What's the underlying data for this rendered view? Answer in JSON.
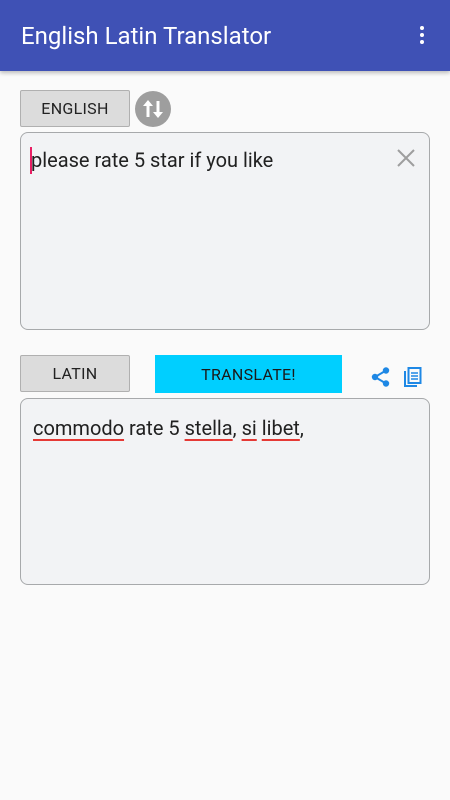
{
  "app": {
    "title": "English Latin Translator"
  },
  "source": {
    "language": "ENGLISH",
    "text": "please rate 5 star if you like"
  },
  "target": {
    "language": "LATIN",
    "segments": [
      {
        "text": "commodo",
        "misspelled": true
      },
      {
        "text": " rate 5 ",
        "misspelled": false
      },
      {
        "text": "stella",
        "misspelled": true
      },
      {
        "text": ", ",
        "misspelled": false
      },
      {
        "text": "si",
        "misspelled": true
      },
      {
        "text": " ",
        "misspelled": false
      },
      {
        "text": "libet",
        "misspelled": true
      },
      {
        "text": ",",
        "misspelled": false
      }
    ]
  },
  "actions": {
    "translate_label": "TRANSLATE!"
  },
  "icons": {
    "overflow": "more-vert-icon",
    "swap": "swap-vert-icon",
    "clear": "close-icon",
    "share": "share-icon",
    "copy": "copy-icon"
  },
  "colors": {
    "appbar": "#3f51b5",
    "translate_button": "#00cfff",
    "accent_icons": "#1e88e5",
    "caret": "#e91e63",
    "spellcheck_underline": "#e53935"
  }
}
